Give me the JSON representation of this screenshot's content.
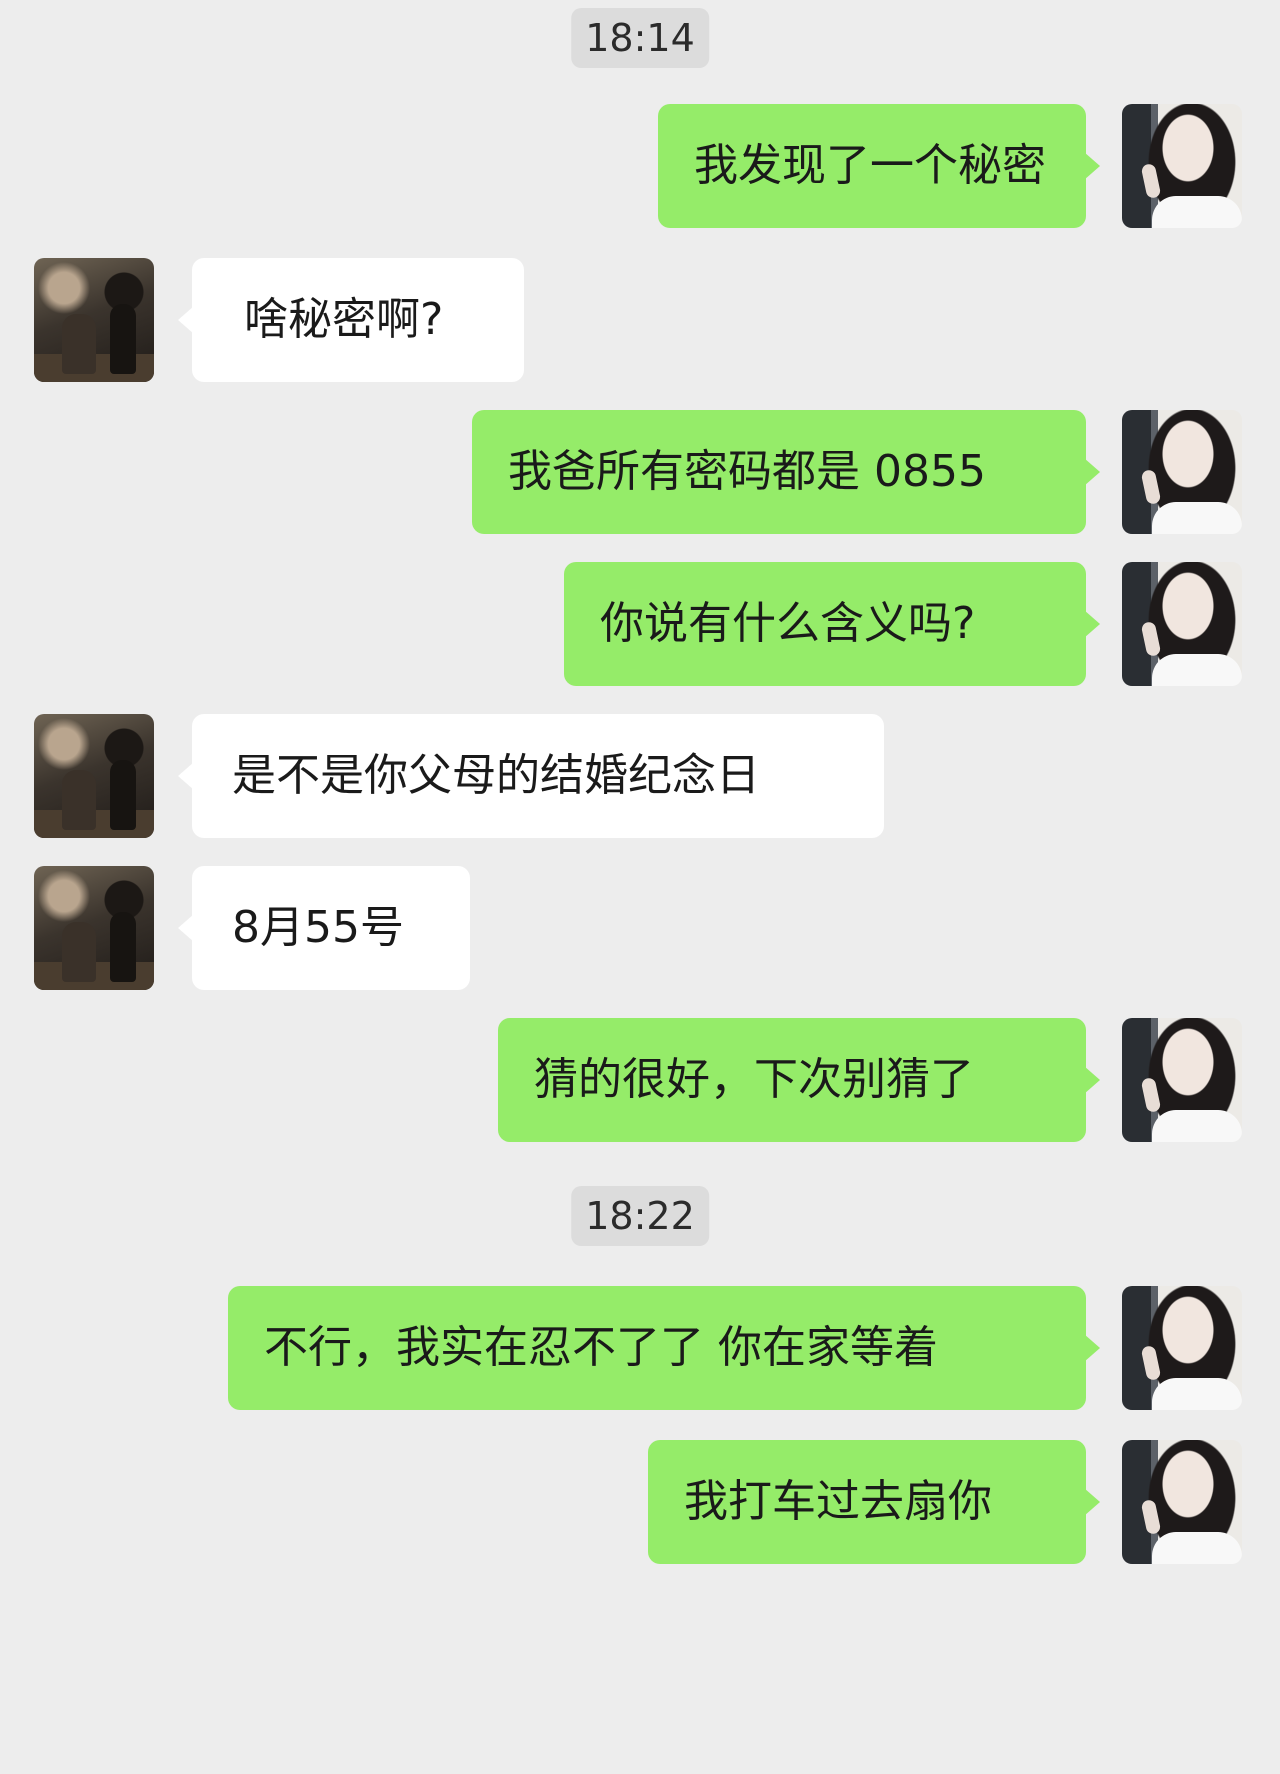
{
  "timestamps": [
    "18:14",
    "18:22"
  ],
  "messages": [
    {
      "side": "out",
      "text": "我发现了一个秘密"
    },
    {
      "side": "in",
      "text": "啥秘密啊?"
    },
    {
      "side": "out",
      "text": "我爸所有密码都是 0855"
    },
    {
      "side": "out",
      "text": "你说有什么含义吗?"
    },
    {
      "side": "in",
      "text": "是不是你父母的结婚纪念日"
    },
    {
      "side": "in",
      "text": "8月55号"
    },
    {
      "side": "out",
      "text": "猜的很好，下次别猜了"
    },
    {
      "side": "out",
      "text": "不行，我实在忍不了了 你在家等着"
    },
    {
      "side": "out",
      "text": "我打车过去扇你"
    }
  ],
  "colors": {
    "background": "#ededed",
    "outgoing_bubble": "#95ec69",
    "incoming_bubble": "#ffffff",
    "timestamp_bg": "#dcdcdc"
  }
}
